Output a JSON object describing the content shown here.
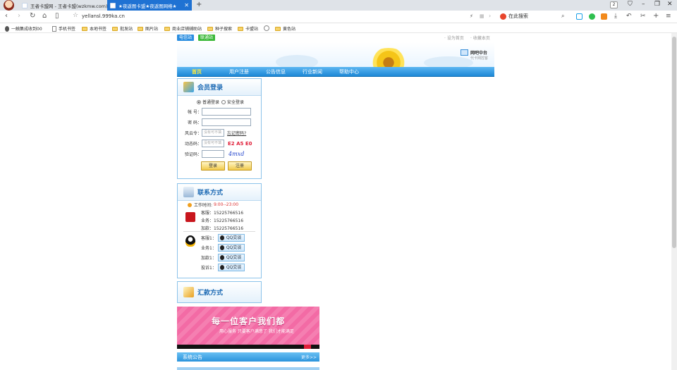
{
  "browser": {
    "tabs": [
      {
        "title": "王者卡盟网 - 王者卡盟(wzkmw.com)",
        "active": false
      },
      {
        "title": "★夜返图卡盟★夜返图网络★",
        "active": true
      }
    ],
    "tab_count": "2",
    "url": "yellansl.999ka.cn",
    "search_placeholder": "在此搜索",
    "bookmarks": [
      {
        "label": "一触集成收到00",
        "icon": "user-icon"
      },
      {
        "label": "手机书签",
        "icon": "doc-icon"
      },
      {
        "label": "本地书签",
        "icon": "folder-icon"
      },
      {
        "label": "批发站",
        "icon": "folder-icon"
      },
      {
        "label": "图片站",
        "icon": "folder-icon"
      },
      {
        "label": "商业店铺辅助站",
        "icon": "folder-icon"
      },
      {
        "label": "种子搜索",
        "icon": "folder-icon"
      },
      {
        "label": "卡盟站",
        "icon": "folder-icon"
      },
      {
        "label": "",
        "icon": "globe-icon"
      },
      {
        "label": "黄色站",
        "icon": "folder-icon"
      }
    ]
  },
  "site": {
    "top_buttons": [
      "电信站",
      "联通站"
    ],
    "top_links": [
      "设为首页",
      "收藏本页"
    ],
    "agent": {
      "title": "网吧中台",
      "subtitle": "代卡网控客"
    },
    "nav": [
      "首页",
      "用户注册",
      "公告信息",
      "行业新闻",
      "帮助中心"
    ],
    "login": {
      "title": "会员登录",
      "radio_normal": "普通登录",
      "radio_secure": "安全登录",
      "account_label": "帐 号：",
      "password_label": "密 码：",
      "fengyun_label": "风云令：",
      "fengyun_placeholder": "没有可不填",
      "forgot": "忘记密码?",
      "dynamic_label": "动态码：",
      "dynamic_placeholder": "没有可不填",
      "dynamic_code": "E2 A5 E0",
      "verify_label": "验证码：",
      "captcha": "4mxd",
      "login_button": "登录",
      "register_button": "注册"
    },
    "contact": {
      "title": "联系方式",
      "worktime_label": "工作时间:",
      "worktime_value": "9:00--23:00",
      "phones": [
        {
          "label": "客服：",
          "value": "15225766516"
        },
        {
          "label": "业务：",
          "value": "15225766516"
        },
        {
          "label": "加款：",
          "value": "15225766516"
        }
      ],
      "qq": [
        {
          "label": "客服1：",
          "button": "QQ交谈"
        },
        {
          "label": "业务1：",
          "button": "QQ交谈"
        },
        {
          "label": "加款1：",
          "button": "QQ交谈"
        },
        {
          "label": "投诉1：",
          "button": "QQ交谈"
        }
      ]
    },
    "remit": {
      "title": "汇款方式"
    },
    "promo": {
      "headline": "每一位客户我们都",
      "sub": "用心服务 只要客户满意了 我们才能满足"
    },
    "notice": {
      "title": "系统公告",
      "more": "更多>>"
    }
  }
}
